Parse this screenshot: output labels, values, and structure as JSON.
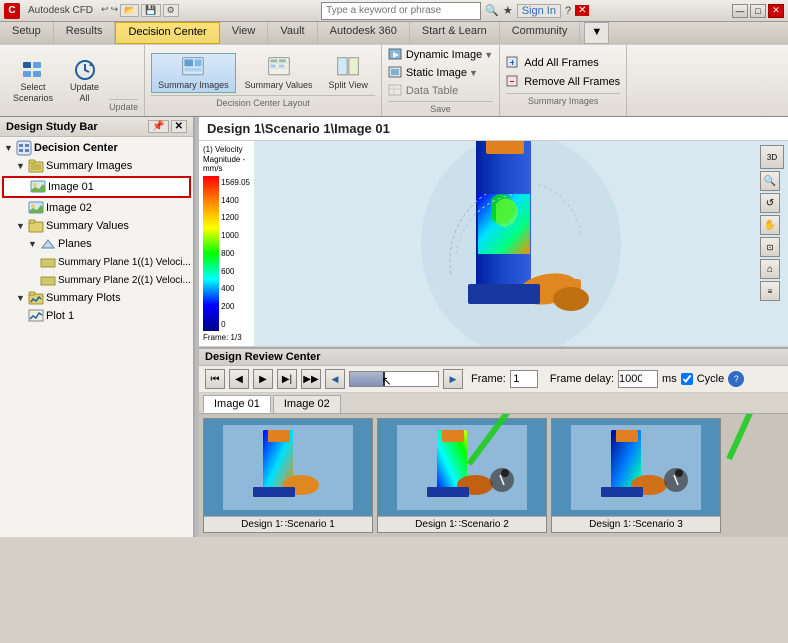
{
  "app": {
    "title": "Autodesk CFD",
    "logo": "C"
  },
  "titlebar": {
    "controls": [
      "—",
      "□",
      "✕"
    ]
  },
  "menubar": {
    "items": [
      {
        "label": "Setup",
        "active": false
      },
      {
        "label": "Results",
        "active": false
      },
      {
        "label": "Decision Center",
        "active": true,
        "highlighted": true
      },
      {
        "label": "View",
        "active": false
      },
      {
        "label": "Vault",
        "active": false
      },
      {
        "label": "Autodesk 360",
        "active": false
      },
      {
        "label": "Start & Learn",
        "active": false
      },
      {
        "label": "Community",
        "active": false
      }
    ]
  },
  "toolbar": {
    "update_group": {
      "select_scenarios_label": "Select\nScenarios",
      "update_all_label": "Update\nAll"
    },
    "decision_center": {
      "summary_images_label": "Summary\nImages",
      "summary_values_label": "Summary\nValues",
      "split_view_label": "Split\nView",
      "section_label": "Decision Center Layout"
    },
    "save_group": {
      "dynamic_image_label": "Dynamic Image",
      "static_image_label": "Static Image",
      "data_table_label": "Data Table",
      "section_label": "Save"
    },
    "summary_images": {
      "add_all_frames_label": "Add All Frames",
      "remove_all_frames_label": "Remove All Frames",
      "section_label": "Summary Images"
    }
  },
  "searchbar": {
    "placeholder": "Type a keyword or phrase",
    "sign_in_label": "Sign In"
  },
  "sidebar": {
    "title": "Design Study Bar",
    "tree": [
      {
        "id": "decision-center",
        "label": "Decision Center",
        "level": 0,
        "expanded": true,
        "type": "root"
      },
      {
        "id": "summary-images",
        "label": "Summary Images",
        "level": 1,
        "expanded": true,
        "type": "folder"
      },
      {
        "id": "image-01",
        "label": "Image 01",
        "level": 2,
        "expanded": false,
        "type": "image",
        "selected": true
      },
      {
        "id": "image-02",
        "label": "Image 02",
        "level": 2,
        "expanded": false,
        "type": "image"
      },
      {
        "id": "summary-values",
        "label": "Summary Values",
        "level": 1,
        "expanded": true,
        "type": "folder"
      },
      {
        "id": "planes",
        "label": "Planes",
        "level": 2,
        "expanded": true,
        "type": "folder"
      },
      {
        "id": "summary-plane-1",
        "label": "Summary Plane 1((1) Veloci...",
        "level": 3,
        "type": "plane"
      },
      {
        "id": "summary-plane-2",
        "label": "Summary Plane 2((1) Veloci...",
        "level": 3,
        "type": "plane"
      },
      {
        "id": "summary-plots",
        "label": "Summary Plots",
        "level": 1,
        "expanded": true,
        "type": "folder"
      },
      {
        "id": "plot-1",
        "label": "Plot 1",
        "level": 2,
        "type": "plot"
      }
    ]
  },
  "content": {
    "title": "Design 1\\Scenario 1\\Image 01",
    "legend": {
      "title": "(1) Velocity Magnitude - mm/s",
      "max_value": "1569.05",
      "labels": [
        "1400",
        "1200",
        "1000",
        "800",
        "600",
        "400",
        "200",
        "0"
      ]
    },
    "frame_info": "Frame: 1/3"
  },
  "review_center": {
    "title": "Design Review Center",
    "playback": {
      "rewind_to_start": "⏮",
      "step_back": "⏴",
      "play": "▶",
      "step_forward": "⏵",
      "fast_forward": "⏭"
    },
    "frame_label": "Frame:",
    "frame_value": "1",
    "frame_delay_label": "Frame delay:",
    "frame_delay_value": "1000",
    "ms_label": "ms",
    "cycle_label": "Cycle",
    "tabs": [
      "Image 01",
      "Image 02"
    ]
  },
  "thumbnails": [
    {
      "label": "Design 1∷Scenario 1"
    },
    {
      "label": "Design 1∷Scenario 2"
    },
    {
      "label": "Design 1∷Scenario 3"
    }
  ],
  "colors": {
    "accent_blue": "#316ac5",
    "highlight_yellow": "#fce17a",
    "selected_border": "#cc0000",
    "toolbar_bg": "#f5f3ef",
    "legend_gradient_top": "#ff0000",
    "legend_gradient_bottom": "#00008b"
  }
}
